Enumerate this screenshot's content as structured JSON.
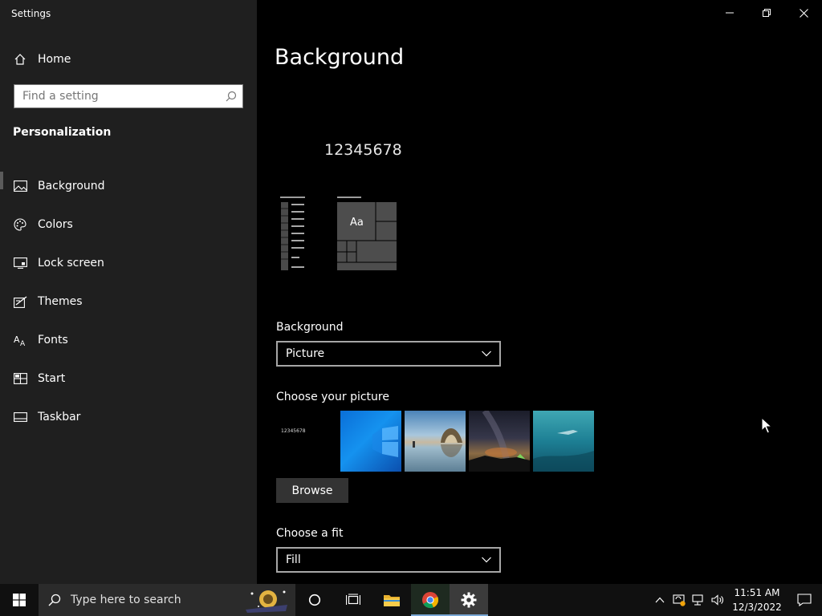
{
  "window": {
    "title": "Settings",
    "buttons": {
      "minimize": "minimize",
      "restore": "restore",
      "close": "close"
    }
  },
  "sidebar": {
    "home_label": "Home",
    "search_placeholder": "Find a setting",
    "section_title": "Personalization",
    "items": [
      {
        "label": "Background",
        "icon": "picture-icon",
        "active": true
      },
      {
        "label": "Colors",
        "icon": "palette-icon",
        "active": false
      },
      {
        "label": "Lock screen",
        "icon": "lock-screen-icon",
        "active": false
      },
      {
        "label": "Themes",
        "icon": "themes-icon",
        "active": false
      },
      {
        "label": "Fonts",
        "icon": "fonts-icon",
        "active": false
      },
      {
        "label": "Start",
        "icon": "start-icon",
        "active": false
      },
      {
        "label": "Taskbar",
        "icon": "taskbar-icon",
        "active": false
      }
    ]
  },
  "main": {
    "title": "Background",
    "preview": {
      "text": "12345678",
      "tile_text": "Aa"
    },
    "background_label": "Background",
    "background_value": "Picture",
    "choose_picture_label": "Choose your picture",
    "thumbnails": [
      {
        "name": "text-wallpaper",
        "text": "12345678"
      },
      {
        "name": "windows-blue-wallpaper"
      },
      {
        "name": "rock-arch-reflection-wallpaper"
      },
      {
        "name": "night-sky-tent-wallpaper"
      },
      {
        "name": "underwater-swimmer-wallpaper"
      }
    ],
    "browse_label": "Browse",
    "choose_fit_label": "Choose a fit",
    "fit_value": "Fill"
  },
  "taskbar": {
    "search_text": "Type here to search",
    "apps": [
      "cortana-icon",
      "task-view-icon",
      "file-explorer-icon",
      "chrome-icon",
      "settings-gear-icon"
    ],
    "time": "11:51 AM",
    "date": "12/3/2022"
  },
  "colors": {
    "sidebar_bg": "#1f1f1f",
    "main_bg": "#000000",
    "taskbar_bg": "#101010",
    "accent_underline": "#7aa8d6"
  }
}
